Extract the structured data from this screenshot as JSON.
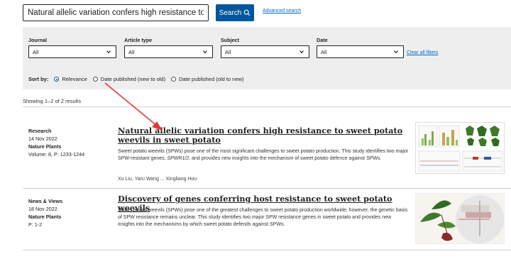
{
  "search": {
    "query": "Natural allelic variation confers high resistance to sweet p",
    "button_label": "Search",
    "advanced_link": "Advanced search"
  },
  "filters": [
    {
      "label": "Journal",
      "value": "All"
    },
    {
      "label": "Article type",
      "value": "All"
    },
    {
      "label": "Subject",
      "value": "All"
    },
    {
      "label": "Date",
      "value": "All"
    }
  ],
  "clear_filters": "Clear all filters",
  "sort": {
    "label": "Sort by:",
    "options": [
      {
        "label": "Relevance",
        "selected": true
      },
      {
        "label": "Date published (new to old)",
        "selected": false
      },
      {
        "label": "Date published (old to new)",
        "selected": false
      }
    ]
  },
  "results_count": "Showing 1–2 of 2 results",
  "results": [
    {
      "type": "Research",
      "date": "14 Nov 2022",
      "journal": "Nature Plants",
      "volume": "Volume: 8, P: 1233-1244",
      "title": "Natural allelic variation confers high resistance to sweet potato weevils in sweet potato",
      "abstract_pre": "Sweet potato weevils (SPWs) pose one of the most significant challenges to sweet potato production. This study identifies two major SPW-resistant genes, ",
      "abstract_em": "SPWR1/2",
      "abstract_post": ", and provides new insights into the mechanism of sweet potato defence against SPWs.",
      "authors": "Xu Liu, Yaru Wang ... Xingliang Hou"
    },
    {
      "type": "News & Views",
      "date": "18 Nov 2022",
      "journal": "Nature Plants",
      "volume": "P: 1-2",
      "title": "Discovery of genes conferring host resistance to sweet potato weevils",
      "abstract": "Sweet potato weevils (SPWs) pose one of the greatest challenges to sweet potato production worldwide; however, the genetic basis of SPW resistance remains unclear. This study identifies two major SPW resistance genes in sweet potato and provides new insights into the mechanisms by which sweet potato defends against SPWs."
    }
  ],
  "colors": {
    "accent": "#01579b",
    "link": "#0067c5",
    "panel": "#eeeeee",
    "annotation_arrow": "#e03a3a"
  }
}
